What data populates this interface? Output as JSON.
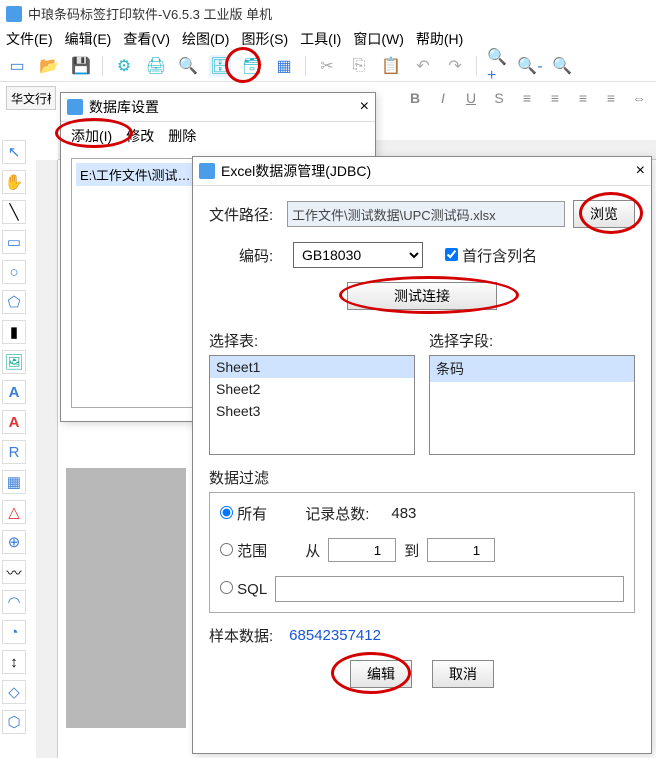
{
  "app": {
    "title": "中琅条码标签打印软件-V6.5.3 工业版 单机"
  },
  "menu": {
    "file": "文件(E)",
    "edit": "编辑(E)",
    "view": "查看(V)",
    "draw": "绘图(D)",
    "shape": "图形(S)",
    "tool": "工具(I)",
    "window": "窗口(W)",
    "help": "帮助(H)"
  },
  "fontbar": {
    "font": "华文行楷"
  },
  "dbDialog": {
    "title": "数据库设置",
    "add": "添加(I)",
    "modify": "修改",
    "delete": "删除",
    "path": "E:\\工作文件\\测试…"
  },
  "jdbc": {
    "title": "Excel数据源管理(JDBC)",
    "filePathLabel": "文件路径:",
    "filePath": "工作文件\\测试数据\\UPC测试码.xlsx",
    "browse": "浏览",
    "encodingLabel": "编码:",
    "encoding": "GB18030",
    "firstRowHeader": "首行含列名",
    "testConn": "测试连接",
    "selectTable": "选择表:",
    "tables": [
      "Sheet1",
      "Sheet2",
      "Sheet3"
    ],
    "selectField": "选择字段:",
    "fields": [
      "条码"
    ],
    "filterTitle": "数据过滤",
    "all": "所有",
    "range": "范围",
    "sql": "SQL",
    "totalLabel": "记录总数:",
    "total": "483",
    "from": "从",
    "fromVal": "1",
    "to": "到",
    "toVal": "1",
    "sampleLabel": "样本数据:",
    "sample": "68542357412",
    "edit": "编辑",
    "cancel": "取消"
  }
}
